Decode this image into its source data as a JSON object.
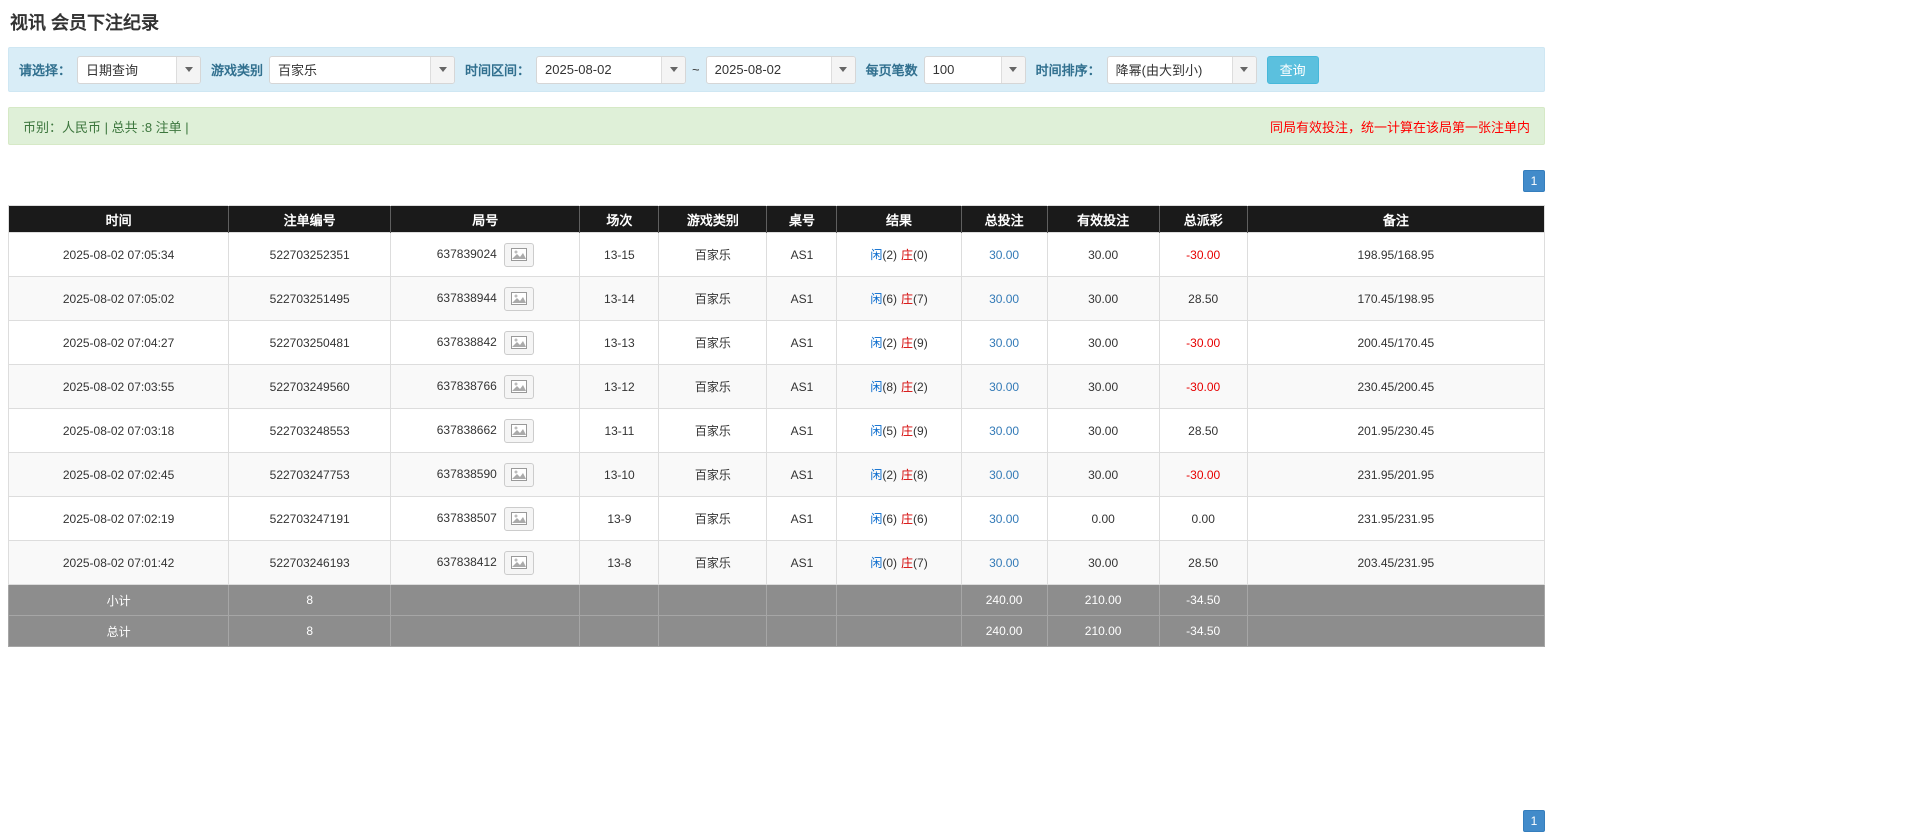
{
  "page": {
    "title": "视讯 会员下注纪录"
  },
  "filters": {
    "select": {
      "label": "请选择：",
      "value": "日期查询"
    },
    "game_type": {
      "label": "游戏类别",
      "value": "百家乐"
    },
    "date_range": {
      "label": "时间区间：",
      "from": "2025-08-02",
      "separator": "~",
      "to": "2025-08-02"
    },
    "page_size": {
      "label": "每页笔数",
      "value": "100"
    },
    "sort": {
      "label": "时间排序：",
      "value": "降幂(由大到小)"
    },
    "search_button": "查询"
  },
  "summary_bar": {
    "currency_info": "币别：人民币 | 总共 :8 注单 |",
    "notice": "同局有效投注，统一计算在该局第一张注单内"
  },
  "pagination": {
    "current_page": "1"
  },
  "table": {
    "headers": [
      "时间",
      "注单编号",
      "局号",
      "场次",
      "游戏类别",
      "桌号",
      "结果",
      "总投注",
      "有效投注",
      "总派彩",
      "备注"
    ],
    "rows": [
      {
        "time": "2025-08-02 07:05:34",
        "bet_id": "522703252351",
        "round_id": "637839024",
        "session": "13-15",
        "game_type": "百家乐",
        "table_no": "AS1",
        "result": {
          "player_label": "闲",
          "player_num": "(2)",
          "banker_label": "庄",
          "banker_num": "(0)"
        },
        "total_bet": "30.00",
        "valid_bet": "30.00",
        "payout": "-30.00",
        "remark": "198.95/168.95"
      },
      {
        "time": "2025-08-02 07:05:02",
        "bet_id": "522703251495",
        "round_id": "637838944",
        "session": "13-14",
        "game_type": "百家乐",
        "table_no": "AS1",
        "result": {
          "player_label": "闲",
          "player_num": "(6)",
          "banker_label": "庄",
          "banker_num": "(7)"
        },
        "total_bet": "30.00",
        "valid_bet": "30.00",
        "payout": "28.50",
        "remark": "170.45/198.95"
      },
      {
        "time": "2025-08-02 07:04:27",
        "bet_id": "522703250481",
        "round_id": "637838842",
        "session": "13-13",
        "game_type": "百家乐",
        "table_no": "AS1",
        "result": {
          "player_label": "闲",
          "player_num": "(2)",
          "banker_label": "庄",
          "banker_num": "(9)"
        },
        "total_bet": "30.00",
        "valid_bet": "30.00",
        "payout": "-30.00",
        "remark": "200.45/170.45"
      },
      {
        "time": "2025-08-02 07:03:55",
        "bet_id": "522703249560",
        "round_id": "637838766",
        "session": "13-12",
        "game_type": "百家乐",
        "table_no": "AS1",
        "result": {
          "player_label": "闲",
          "player_num": "(8)",
          "banker_label": "庄",
          "banker_num": "(2)"
        },
        "total_bet": "30.00",
        "valid_bet": "30.00",
        "payout": "-30.00",
        "remark": "230.45/200.45"
      },
      {
        "time": "2025-08-02 07:03:18",
        "bet_id": "522703248553",
        "round_id": "637838662",
        "session": "13-11",
        "game_type": "百家乐",
        "table_no": "AS1",
        "result": {
          "player_label": "闲",
          "player_num": "(5)",
          "banker_label": "庄",
          "banker_num": "(9)"
        },
        "total_bet": "30.00",
        "valid_bet": "30.00",
        "payout": "28.50",
        "remark": "201.95/230.45"
      },
      {
        "time": "2025-08-02 07:02:45",
        "bet_id": "522703247753",
        "round_id": "637838590",
        "session": "13-10",
        "game_type": "百家乐",
        "table_no": "AS1",
        "result": {
          "player_label": "闲",
          "player_num": "(2)",
          "banker_label": "庄",
          "banker_num": "(8)"
        },
        "total_bet": "30.00",
        "valid_bet": "30.00",
        "payout": "-30.00",
        "remark": "231.95/201.95"
      },
      {
        "time": "2025-08-02 07:02:19",
        "bet_id": "522703247191",
        "round_id": "637838507",
        "session": "13-9",
        "game_type": "百家乐",
        "table_no": "AS1",
        "result": {
          "player_label": "闲",
          "player_num": "(6)",
          "banker_label": "庄",
          "banker_num": "(6)"
        },
        "total_bet": "30.00",
        "valid_bet": "0.00",
        "payout": "0.00",
        "remark": "231.95/231.95"
      },
      {
        "time": "2025-08-02 07:01:42",
        "bet_id": "522703246193",
        "round_id": "637838412",
        "session": "13-8",
        "game_type": "百家乐",
        "table_no": "AS1",
        "result": {
          "player_label": "闲",
          "player_num": "(0)",
          "banker_label": "庄",
          "banker_num": "(7)"
        },
        "total_bet": "30.00",
        "valid_bet": "30.00",
        "payout": "28.50",
        "remark": "203.45/231.95"
      }
    ],
    "subtotal": {
      "label": "小计",
      "count": "8",
      "total_bet": "240.00",
      "valid_bet": "210.00",
      "payout": "-34.50"
    },
    "grand_total": {
      "label": "总计",
      "count": "8",
      "total_bet": "240.00",
      "valid_bet": "210.00",
      "payout": "-34.50"
    }
  },
  "colors": {
    "filter_bar_bg": "#d9edf7",
    "filter_label_blue": "#31708f",
    "summary_bar_bg": "#dff0d8",
    "notice_red": "#ff0000",
    "search_button_blue": "#5bc0de",
    "pagination_blue": "#428bca",
    "table_header_bg": "#1a1a1a",
    "table_footer_bg": "#8d8d8d",
    "player_blue": "#0066cc",
    "banker_red": "#d40000",
    "bet_link_blue": "#337ab7",
    "negative_red": "#e60000"
  }
}
